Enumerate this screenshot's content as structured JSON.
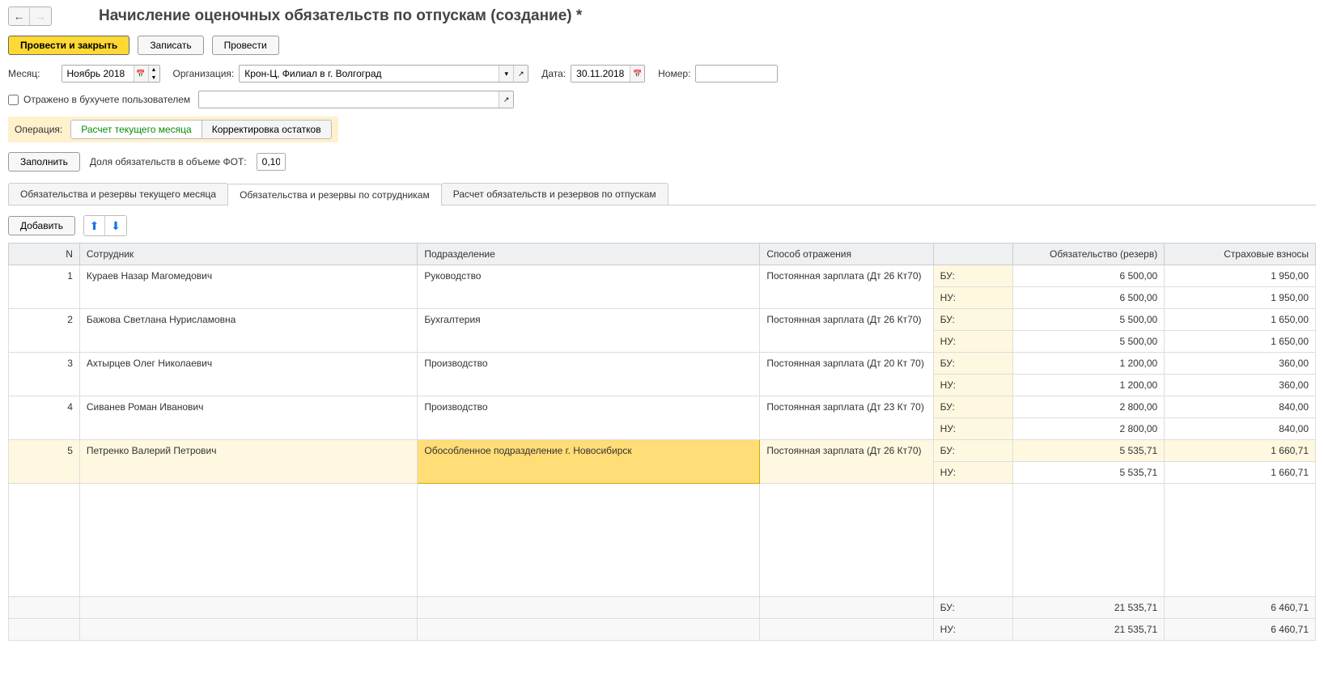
{
  "header": {
    "title": "Начисление оценочных обязательств по отпускам (создание) *"
  },
  "commands": {
    "post_close": "Провести и закрыть",
    "write": "Записать",
    "post": "Провести"
  },
  "form": {
    "month_label": "Месяц:",
    "month_value": "Ноябрь 2018",
    "org_label": "Организация:",
    "org_value": "Крон-Ц, Филиал в г. Волгоград",
    "date_label": "Дата:",
    "date_value": "30.11.2018",
    "number_label": "Номер:",
    "number_value": "",
    "reflected_label": "Отражено в бухучете пользователем",
    "reflected_value": "",
    "operation_label": "Операция:",
    "op_current": "Расчет текущего месяца",
    "op_correction": "Корректировка остатков",
    "fill_btn": "Заполнить",
    "share_label": "Доля обязательств в объеме ФОТ:",
    "share_value": "0,10"
  },
  "tabs": {
    "t1": "Обязательства и резервы текущего месяца",
    "t2": "Обязательства и резервы по сотрудникам",
    "t3": "Расчет обязательств и резервов по отпускам"
  },
  "table_cmds": {
    "add": "Добавить"
  },
  "columns": {
    "n": "N",
    "employee": "Сотрудник",
    "department": "Подразделение",
    "method": "Способ отражения",
    "acc": "",
    "obligation": "Обязательство (резерв)",
    "insurance": "Страховые взносы"
  },
  "acc_labels": {
    "bu": "БУ:",
    "nu": "НУ:"
  },
  "rows": [
    {
      "n": "1",
      "employee": "Кураев Назар Магомедович",
      "department": "Руководство",
      "method": "Постоянная зарплата (Дт 26 Кт70)",
      "bu_ob": "6 500,00",
      "bu_ins": "1 950,00",
      "nu_ob": "6 500,00",
      "nu_ins": "1 950,00"
    },
    {
      "n": "2",
      "employee": "Бажова Светлана Нурисламовна",
      "department": "Бухгалтерия",
      "method": "Постоянная зарплата (Дт 26 Кт70)",
      "bu_ob": "5 500,00",
      "bu_ins": "1 650,00",
      "nu_ob": "5 500,00",
      "nu_ins": "1 650,00"
    },
    {
      "n": "3",
      "employee": "Ахтырцев Олег Николаевич",
      "department": "Производство",
      "method": "Постоянная зарплата (Дт 20 Кт 70)",
      "bu_ob": "1 200,00",
      "bu_ins": "360,00",
      "nu_ob": "1 200,00",
      "nu_ins": "360,00"
    },
    {
      "n": "4",
      "employee": "Сиванев Роман Иванович",
      "department": "Производство",
      "method": "Постоянная зарплата (Дт 23 Кт 70)",
      "bu_ob": "2 800,00",
      "bu_ins": "840,00",
      "nu_ob": "2 800,00",
      "nu_ins": "840,00"
    },
    {
      "n": "5",
      "employee": "Петренко Валерий Петрович",
      "department": "Обособленное подразделение г. Новосибирск",
      "method": "Постоянная зарплата (Дт 26 Кт70)",
      "bu_ob": "5 535,71",
      "bu_ins": "1 660,71",
      "nu_ob": "5 535,71",
      "nu_ins": "1 660,71"
    }
  ],
  "totals": {
    "bu_ob": "21 535,71",
    "bu_ins": "6 460,71",
    "nu_ob": "21 535,71",
    "nu_ins": "6 460,71"
  }
}
